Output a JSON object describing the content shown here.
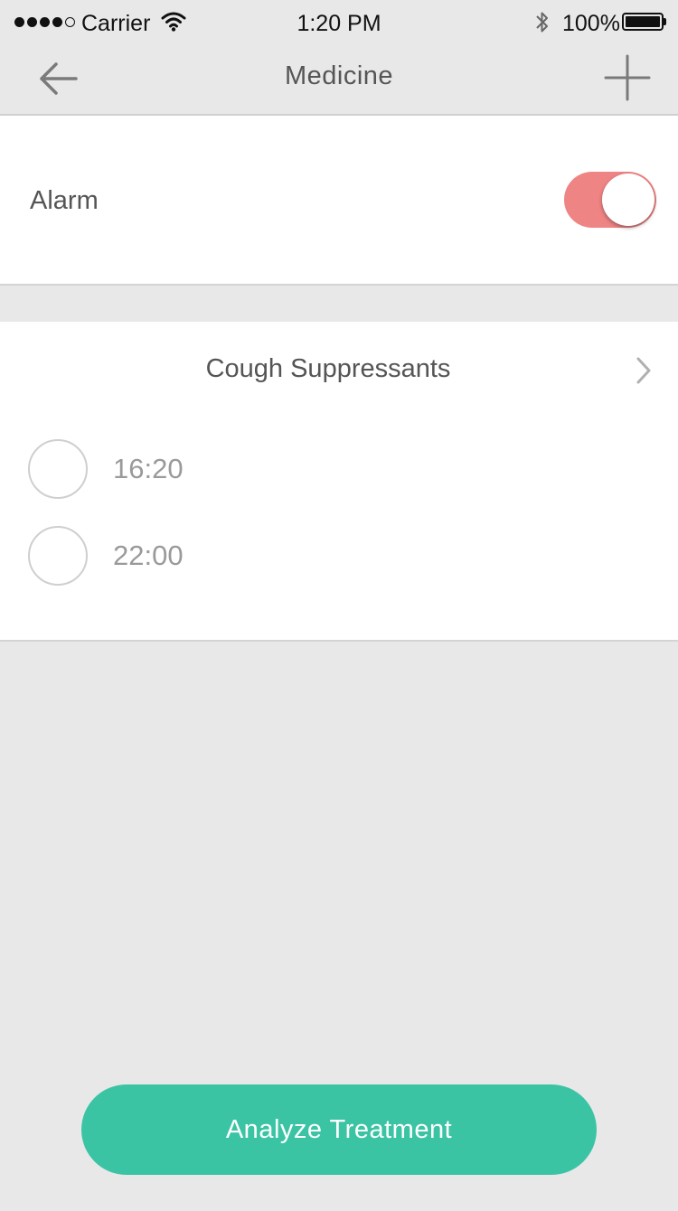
{
  "status_bar": {
    "carrier": "Carrier",
    "time": "1:20 PM",
    "battery": "100%",
    "signal_bars_filled": 4,
    "signal_bars_total": 5
  },
  "nav": {
    "title": "Medicine",
    "back_icon": "back-arrow-icon",
    "add_icon": "plus-icon"
  },
  "alarm": {
    "label": "Alarm",
    "enabled": true,
    "toggle_color": "#ef8484"
  },
  "medicine": {
    "name": "Cough Suppressants",
    "times": [
      {
        "time": "16:20",
        "checked": false
      },
      {
        "time": "22:00",
        "checked": false
      }
    ]
  },
  "actions": {
    "analyze_label": "Analyze Treatment",
    "analyze_color": "#3bc4a4"
  }
}
